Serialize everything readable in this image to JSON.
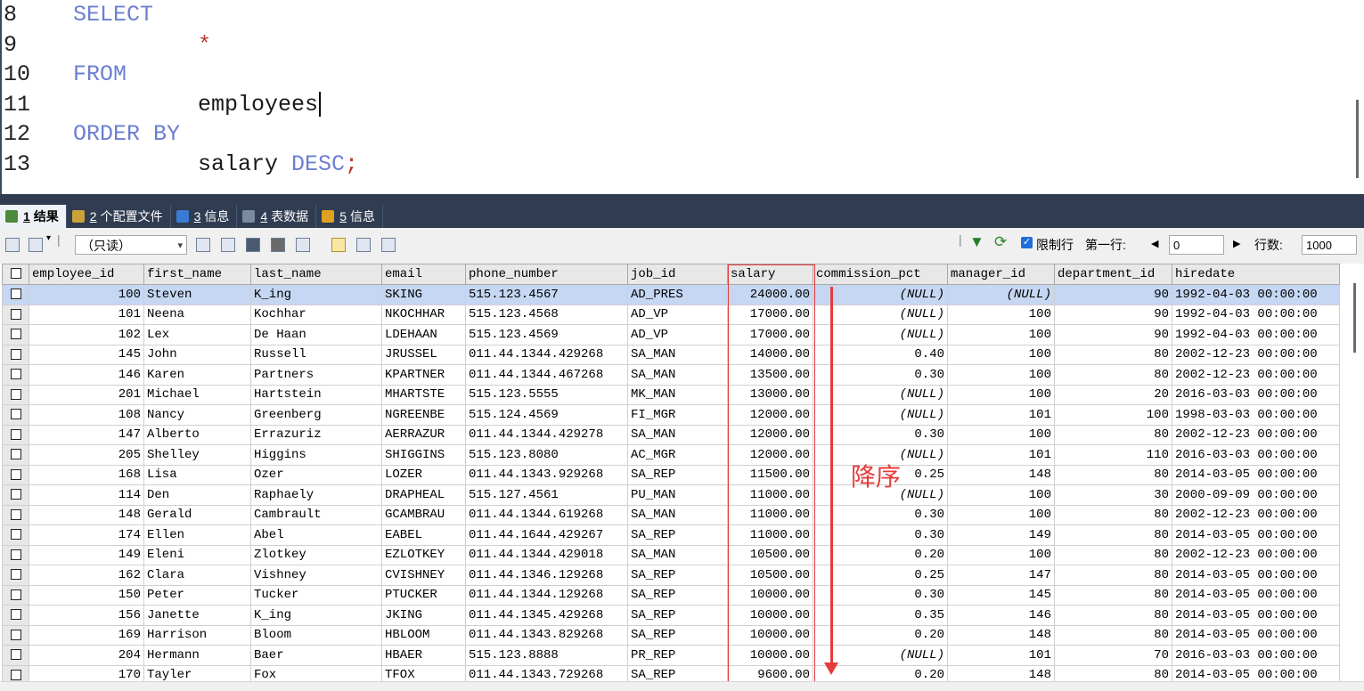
{
  "editor": {
    "lines": [
      {
        "no": "8",
        "text": "SELECT"
      },
      {
        "no": "9",
        "text": "*"
      },
      {
        "no": "10",
        "text": "FROM"
      },
      {
        "no": "11",
        "text": "employees"
      },
      {
        "no": "12",
        "text": "ORDER BY"
      },
      {
        "no": "13",
        "text": "salary",
        "kw": "DESC",
        "punc": ";"
      }
    ]
  },
  "tabs": [
    {
      "num": "1",
      "label": "结果",
      "color": "#4a8a3a"
    },
    {
      "num": "2",
      "label": "个配置文件",
      "color": "#c9a23a"
    },
    {
      "num": "3",
      "label": "信息",
      "color": "#3a7bd5"
    },
    {
      "num": "4",
      "label": "表数据",
      "color": "#7a8aa0"
    },
    {
      "num": "5",
      "label": "信息",
      "color": "#e0a020"
    }
  ],
  "toolbar": {
    "mode": "（只读）",
    "limit_label": "限制行",
    "first_row_label": "第一行:",
    "first_row_value": "0",
    "row_count_label": "行数:",
    "row_count_value": "1000"
  },
  "grid": {
    "columns": [
      "employee_id",
      "first_name",
      "last_name",
      "email",
      "phone_number",
      "job_id",
      "salary",
      "commission_pct",
      "manager_id",
      "department_id",
      "hiredate"
    ],
    "rows": [
      [
        "100",
        "Steven",
        "K_ing",
        "SKING",
        "515.123.4567",
        "AD_PRES",
        "24000.00",
        "(NULL)",
        "(NULL)",
        "90",
        "1992-04-03 00:00:00"
      ],
      [
        "101",
        "Neena",
        "Kochhar",
        "NKOCHHAR",
        "515.123.4568",
        "AD_VP",
        "17000.00",
        "(NULL)",
        "100",
        "90",
        "1992-04-03 00:00:00"
      ],
      [
        "102",
        "Lex",
        "De Haan",
        "LDEHAAN",
        "515.123.4569",
        "AD_VP",
        "17000.00",
        "(NULL)",
        "100",
        "90",
        "1992-04-03 00:00:00"
      ],
      [
        "145",
        "John",
        "Russell",
        "JRUSSEL",
        "011.44.1344.429268",
        "SA_MAN",
        "14000.00",
        "0.40",
        "100",
        "80",
        "2002-12-23 00:00:00"
      ],
      [
        "146",
        "Karen",
        "Partners",
        "KPARTNER",
        "011.44.1344.467268",
        "SA_MAN",
        "13500.00",
        "0.30",
        "100",
        "80",
        "2002-12-23 00:00:00"
      ],
      [
        "201",
        "Michael",
        "Hartstein",
        "MHARTSTE",
        "515.123.5555",
        "MK_MAN",
        "13000.00",
        "(NULL)",
        "100",
        "20",
        "2016-03-03 00:00:00"
      ],
      [
        "108",
        "Nancy",
        "Greenberg",
        "NGREENBE",
        "515.124.4569",
        "FI_MGR",
        "12000.00",
        "(NULL)",
        "101",
        "100",
        "1998-03-03 00:00:00"
      ],
      [
        "147",
        "Alberto",
        "Errazuriz",
        "AERRAZUR",
        "011.44.1344.429278",
        "SA_MAN",
        "12000.00",
        "0.30",
        "100",
        "80",
        "2002-12-23 00:00:00"
      ],
      [
        "205",
        "Shelley",
        "Higgins",
        "SHIGGINS",
        "515.123.8080",
        "AC_MGR",
        "12000.00",
        "(NULL)",
        "101",
        "110",
        "2016-03-03 00:00:00"
      ],
      [
        "168",
        "Lisa",
        "Ozer",
        "LOZER",
        "011.44.1343.929268",
        "SA_REP",
        "11500.00",
        "0.25",
        "148",
        "80",
        "2014-03-05 00:00:00"
      ],
      [
        "114",
        "Den",
        "Raphaely",
        "DRAPHEAL",
        "515.127.4561",
        "PU_MAN",
        "11000.00",
        "(NULL)",
        "100",
        "30",
        "2000-09-09 00:00:00"
      ],
      [
        "148",
        "Gerald",
        "Cambrault",
        "GCAMBRAU",
        "011.44.1344.619268",
        "SA_MAN",
        "11000.00",
        "0.30",
        "100",
        "80",
        "2002-12-23 00:00:00"
      ],
      [
        "174",
        "Ellen",
        "Abel",
        "EABEL",
        "011.44.1644.429267",
        "SA_REP",
        "11000.00",
        "0.30",
        "149",
        "80",
        "2014-03-05 00:00:00"
      ],
      [
        "149",
        "Eleni",
        "Zlotkey",
        "EZLOTKEY",
        "011.44.1344.429018",
        "SA_MAN",
        "10500.00",
        "0.20",
        "100",
        "80",
        "2002-12-23 00:00:00"
      ],
      [
        "162",
        "Clara",
        "Vishney",
        "CVISHNEY",
        "011.44.1346.129268",
        "SA_REP",
        "10500.00",
        "0.25",
        "147",
        "80",
        "2014-03-05 00:00:00"
      ],
      [
        "150",
        "Peter",
        "Tucker",
        "PTUCKER",
        "011.44.1344.129268",
        "SA_REP",
        "10000.00",
        "0.30",
        "145",
        "80",
        "2014-03-05 00:00:00"
      ],
      [
        "156",
        "Janette",
        "K_ing",
        "JKING",
        "011.44.1345.429268",
        "SA_REP",
        "10000.00",
        "0.35",
        "146",
        "80",
        "2014-03-05 00:00:00"
      ],
      [
        "169",
        "Harrison",
        "Bloom",
        "HBLOOM",
        "011.44.1343.829268",
        "SA_REP",
        "10000.00",
        "0.20",
        "148",
        "80",
        "2014-03-05 00:00:00"
      ],
      [
        "204",
        "Hermann",
        "Baer",
        "HBAER",
        "515.123.8888",
        "PR_REP",
        "10000.00",
        "(NULL)",
        "101",
        "70",
        "2016-03-03 00:00:00"
      ],
      [
        "170",
        "Tayler",
        "Fox",
        "TFOX",
        "011.44.1343.729268",
        "SA_REP",
        "9600.00",
        "0.20",
        "148",
        "80",
        "2014-03-05 00:00:00"
      ]
    ]
  },
  "annotation": {
    "text": "降序",
    "color": "#e63b3b"
  }
}
